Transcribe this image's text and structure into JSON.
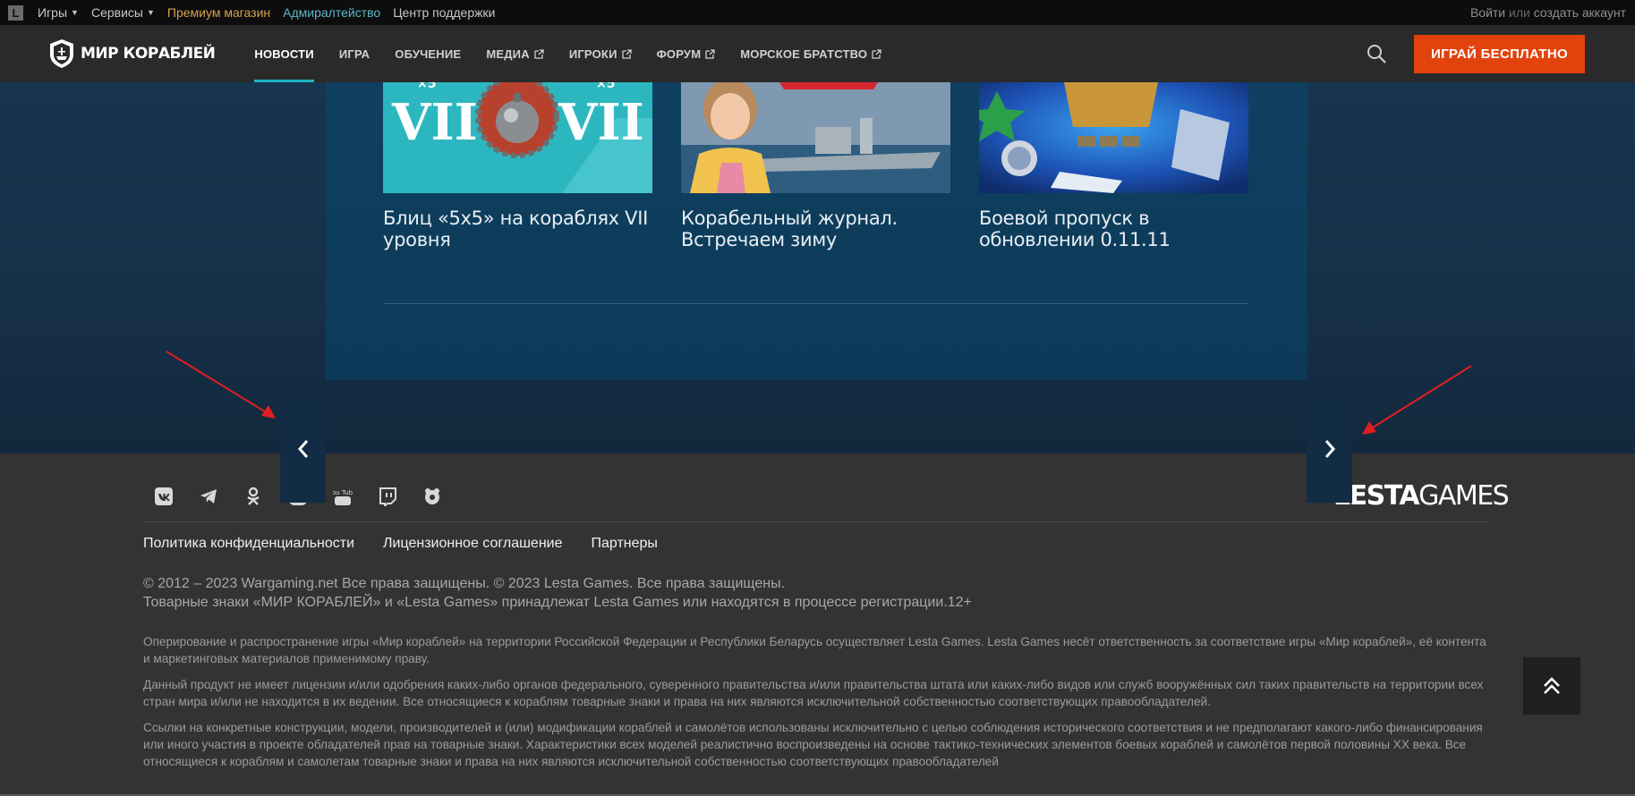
{
  "topbar": {
    "logo_letter": "L",
    "games": "Игры",
    "services": "Сервисы",
    "premium": "Премиум магазин",
    "admiralty": "Адмиралтейство",
    "support": "Центр поддержки",
    "login": "Войти",
    "or": "или",
    "create": "создать аккаунт"
  },
  "nav": {
    "brand": "МИР КОРАБЛЕЙ",
    "links": [
      "НОВОСТИ",
      "ИГРА",
      "ОБУЧЕНИЕ",
      "МЕДИА",
      "ИГРОКИ",
      "ФОРУМ",
      "МОРСКОЕ БРАТСТВО"
    ],
    "active_index": 0,
    "play_button": "ИГРАЙ БЕСПЛАТНО"
  },
  "news": {
    "cards": [
      {
        "title": "Блиц «5x5» на кораблях VII уровня",
        "image": "blitz-vii-emblem"
      },
      {
        "title": "Корабельный журнал. Встречаем зиму",
        "image": "host-and-warship"
      },
      {
        "title": "Боевой пропуск в обновлении 0.11.11",
        "image": "battle-pass-rewards"
      }
    ],
    "card_image_text": {
      "roman": "VII",
      "tier_mark": "×5"
    }
  },
  "slider": {
    "prev_icon": "chevron-left-icon",
    "next_icon": "chevron-right-icon"
  },
  "footer": {
    "socials": [
      "vk-icon",
      "telegram-icon",
      "odnoklassniki-icon",
      "dzen-icon",
      "youtube-icon",
      "twitch-icon",
      "gamepad-icon"
    ],
    "youtube_label": "You Tube",
    "publisher_logo": {
      "bold": "LESTA",
      "light": "GAMES"
    },
    "links": [
      "Политика конфиденциальности",
      "Лицензионное соглашение",
      "Партнеры"
    ],
    "copyright_line1": "© 2012 – 2023 Wargaming.net Все права защищены. © 2023 Lesta Games. Все права защищены.",
    "copyright_line2": "Товарные знаки «МИР КОРАБЛЕЙ» и «Lesta Games» принадлежат Lesta Games или находятся в процессе регистрации.12+",
    "legal": [
      "Оперирование и распространение игры «Мир кораблей» на территории Российской Федерации и Республики Беларусь осуществляет Lesta Games. Lesta Games несёт ответственность за соответствие игры «Мир кораблей», её контента и маркетинговых материалов применимому праву.",
      "Данный продукт не имеет лицензии и/или одобрения каких-либо органов федерального, суверенного правительства и/или правительства штата или каких-либо видов или служб вооружённых сил таких правительств на территории всех стран мира и/или не находится в их ведении. Все относящиеся к кораблям товарные знаки и права на них являются исключительной собственностью соответствующих правообладателей.",
      "Ссылки на конкретные конструкции, модели, производителей и (или) модификации кораблей и самолётов использованы исключительно с целью соблюдения исторического соответствия и не предполагают какого-либо финансирования или иного участия в проекте обладателей прав на товарные знаки. Характеристики всех моделей реалистично воспроизведены на основе тактико-технических элементов боевых кораблей и самолётов первой половины XX века. Все относящиеся к кораблям и самолетам товарные знаки и права на них являются исключительной собственностью соответствующих правообладателей"
    ],
    "scroll_top_icon": "double-chevron-up-icon"
  },
  "colors": {
    "accent": "#1fb3c2",
    "play_button": "#e2430d",
    "premium": "#d6a24a",
    "admiralty": "#5eb6c7",
    "annotation_arrow": "#e02020"
  }
}
